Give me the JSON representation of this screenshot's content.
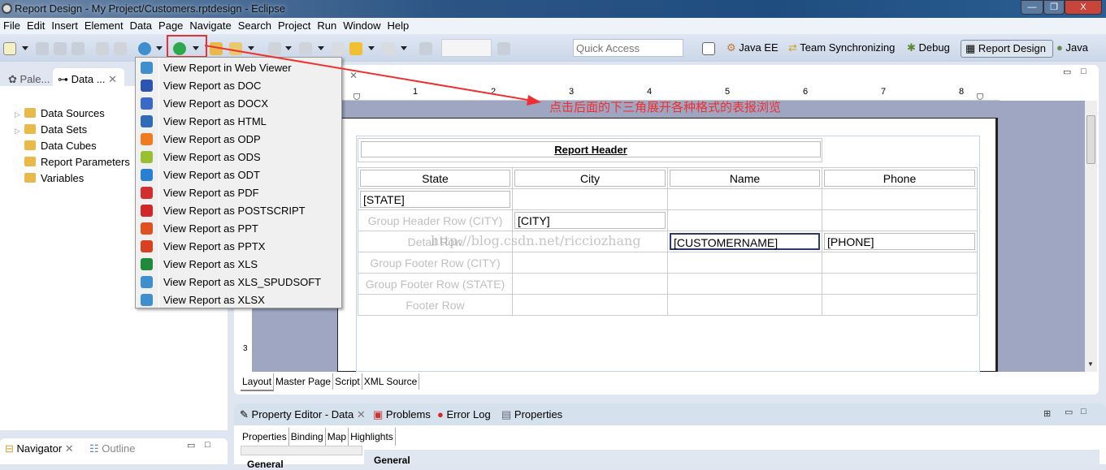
{
  "window": {
    "title": "Report Design - My Project/Customers.rptdesign - Eclipse",
    "minimize": "—",
    "restore": "❐",
    "close": "X"
  },
  "menubar": [
    "File",
    "Edit",
    "Insert",
    "Element",
    "Data",
    "Page",
    "Navigate",
    "Search",
    "Project",
    "Run",
    "Window",
    "Help"
  ],
  "toolbar": {
    "quick_access_placeholder": "Quick Access",
    "highlight_color": "#e33333"
  },
  "perspectives": [
    "Java EE",
    "Team Synchronizing",
    "Debug",
    "Report Design",
    "Java"
  ],
  "active_perspective": "Report Design",
  "left_panel": {
    "tabs": [
      "Pale...",
      "Data ..."
    ],
    "tree": [
      {
        "label": "Data Sources",
        "expandable": true
      },
      {
        "label": "Data Sets",
        "expandable": true
      },
      {
        "label": "Data Cubes",
        "expandable": false
      },
      {
        "label": "Report Parameters",
        "expandable": false
      },
      {
        "label": "Variables",
        "expandable": false
      }
    ]
  },
  "navigator": {
    "tabs": [
      "Navigator",
      "Outline"
    ]
  },
  "preview_menu": {
    "items": [
      {
        "label": "View Report in Web Viewer",
        "icon": "globe-icon",
        "color": "#3f8fcf"
      },
      {
        "label": "View Report as DOC",
        "icon": "word-icon",
        "color": "#2a55b0"
      },
      {
        "label": "View Report as DOCX",
        "icon": "word-icon",
        "color": "#3a6ac8"
      },
      {
        "label": "View Report as HTML",
        "icon": "html-icon",
        "color": "#2f6cb5"
      },
      {
        "label": "View Report as ODP",
        "icon": "odp-icon",
        "color": "#f07a20"
      },
      {
        "label": "View Report as ODS",
        "icon": "ods-icon",
        "color": "#98c030"
      },
      {
        "label": "View Report as ODT",
        "icon": "odt-icon",
        "color": "#2a80d0"
      },
      {
        "label": "View Report as PDF",
        "icon": "pdf-icon",
        "color": "#d03030"
      },
      {
        "label": "View Report as POSTSCRIPT",
        "icon": "postscript-icon",
        "color": "#d02828"
      },
      {
        "label": "View Report as PPT",
        "icon": "ppt-icon",
        "color": "#e05020"
      },
      {
        "label": "View Report as PPTX",
        "icon": "pptx-icon",
        "color": "#d84020"
      },
      {
        "label": "View Report as XLS",
        "icon": "excel-icon",
        "color": "#1f8a3a"
      },
      {
        "label": "View Report as XLS_SPUDSOFT",
        "icon": "globe-icon",
        "color": "#3f8fcf"
      },
      {
        "label": "View Report as XLSX",
        "icon": "globe-icon",
        "color": "#3f8fcf"
      }
    ]
  },
  "annotation": {
    "text": "点击后面的下三角展开各种格式的表报浏览",
    "color": "#f03030"
  },
  "ruler": [
    "1",
    "2",
    "3",
    "4",
    "5",
    "6",
    "7",
    "8"
  ],
  "vruler": "3",
  "report": {
    "header": "Report Header",
    "columns": [
      "State",
      "City",
      "Name",
      "Phone"
    ],
    "state_field": "[STATE]",
    "city_field": "[CITY]",
    "name_field": "[CUSTOMERNAME]",
    "phone_field": "[PHONE]",
    "rows": {
      "group_header_city": "Group Header Row (CITY)",
      "detail": "Detail Row",
      "group_footer_city": "Group Footer Row (CITY)",
      "group_footer_state": "Group Footer Row (STATE)",
      "footer": "Footer Row"
    }
  },
  "watermark": "http://blog.csdn.net/ricciozhang",
  "editor_tabs": [
    "Layout",
    "Master Page",
    "Script",
    "XML Source"
  ],
  "bottom": {
    "tabs": [
      "Property Editor - Data",
      "Problems",
      "Error Log",
      "Properties"
    ],
    "subtabs": [
      "Properties",
      "Binding",
      "Map",
      "Highlights"
    ],
    "section": "General",
    "side_section": "General"
  }
}
